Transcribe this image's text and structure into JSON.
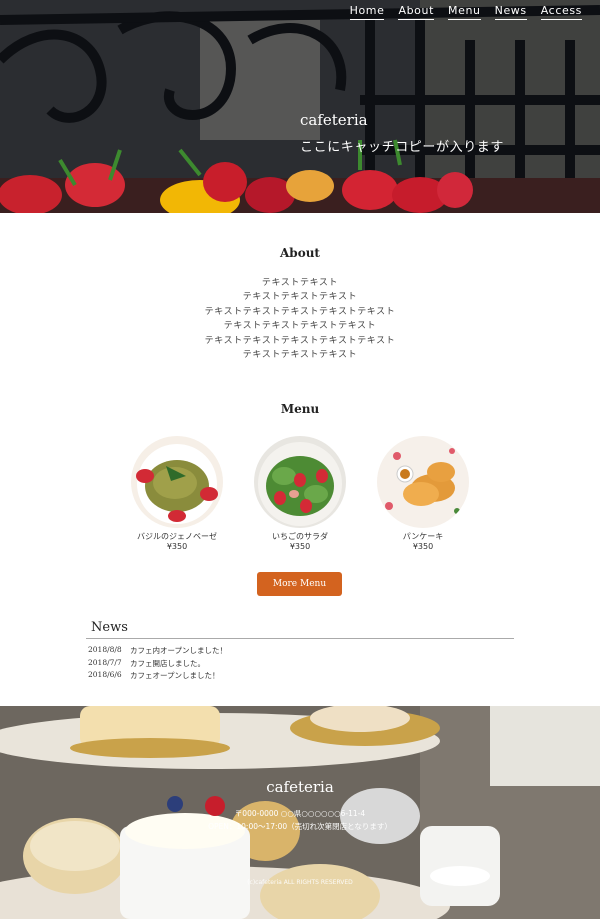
{
  "nav": {
    "items": [
      "Home",
      "About",
      "Menu",
      "News",
      "Access"
    ]
  },
  "hero": {
    "title": "cafeteria",
    "catch_copy": "ここにキャッチコピーが入ります"
  },
  "about": {
    "title": "About",
    "lines": [
      "テキストテキスト",
      "テキストテキストテキスト",
      "テキストテキストテキストテキストテキスト",
      "テキストテキストテキストテキスト",
      "テキストテキストテキストテキストテキスト",
      "テキストテキストテキスト"
    ]
  },
  "menu": {
    "title": "Menu",
    "items": [
      {
        "name": "バジルのジェノベーゼ",
        "price": "¥350"
      },
      {
        "name": "いちごのサラダ",
        "price": "¥350"
      },
      {
        "name": "パンケーキ",
        "price": "¥350"
      }
    ],
    "more_label": "More Menu"
  },
  "news": {
    "title": "News",
    "items": [
      {
        "date": "2018/8/8",
        "text": "カフェ内オープンしました！"
      },
      {
        "date": "2018/7/7",
        "text": "カフェ開店しました。"
      },
      {
        "date": "2018/6/6",
        "text": "カフェオープンしました！"
      }
    ]
  },
  "footer": {
    "title": "cafeteria",
    "address": "〒000-0000 ○○県○○○○○○6-11-4",
    "open": "OPEN：10:00～17:00（売切れ次第閉店となります）",
    "copyright": "(c)cafeteria ALL RIGHTS RESERVED"
  },
  "colors": {
    "accent": "#d3631f",
    "text": "#333333"
  }
}
